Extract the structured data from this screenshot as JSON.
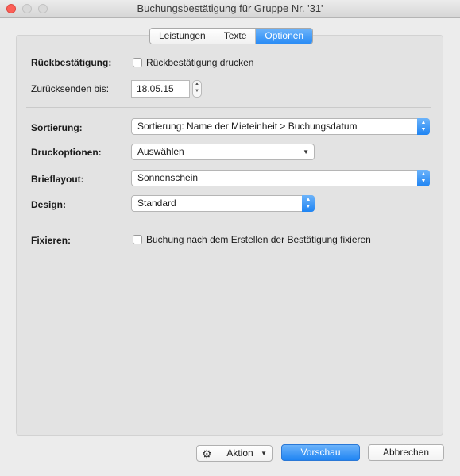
{
  "window": {
    "title": "Buchungsbestätigung für Gruppe Nr. '31'"
  },
  "tabs": [
    {
      "label": "Leistungen",
      "active": false
    },
    {
      "label": "Texte",
      "active": false
    },
    {
      "label": "Optionen",
      "active": true
    }
  ],
  "form": {
    "rueckbestaetigung": {
      "label": "Rückbestätigung:",
      "checkbox_label": "Rückbestätigung drucken",
      "checked": false
    },
    "zuruecksenden": {
      "label": "Zurücksenden bis:",
      "value": "18.05.15"
    },
    "sortierung": {
      "label": "Sortierung:",
      "value": "Sortierung: Name der Mieteinheit > Buchungsdatum"
    },
    "druckoptionen": {
      "label": "Druckoptionen:",
      "value": "Auswählen"
    },
    "brieflayout": {
      "label": "Brieflayout:",
      "value": "Sonnenschein"
    },
    "design": {
      "label": "Design:",
      "value": "Standard"
    },
    "fixieren": {
      "label": "Fixieren:",
      "checkbox_label": "Buchung nach dem Erstellen der Bestätigung fixieren",
      "checked": false
    }
  },
  "buttons": {
    "aktion": "Aktion",
    "vorschau": "Vorschau",
    "abbrechen": "Abbrechen"
  },
  "icons": {
    "close": "close-icon",
    "minimize": "minimize-icon",
    "zoom": "zoom-icon",
    "gear": "gear-icon"
  },
  "colors": {
    "accent": "#2a8cf5",
    "close": "#fc5f57",
    "window_bg": "#ececec"
  }
}
